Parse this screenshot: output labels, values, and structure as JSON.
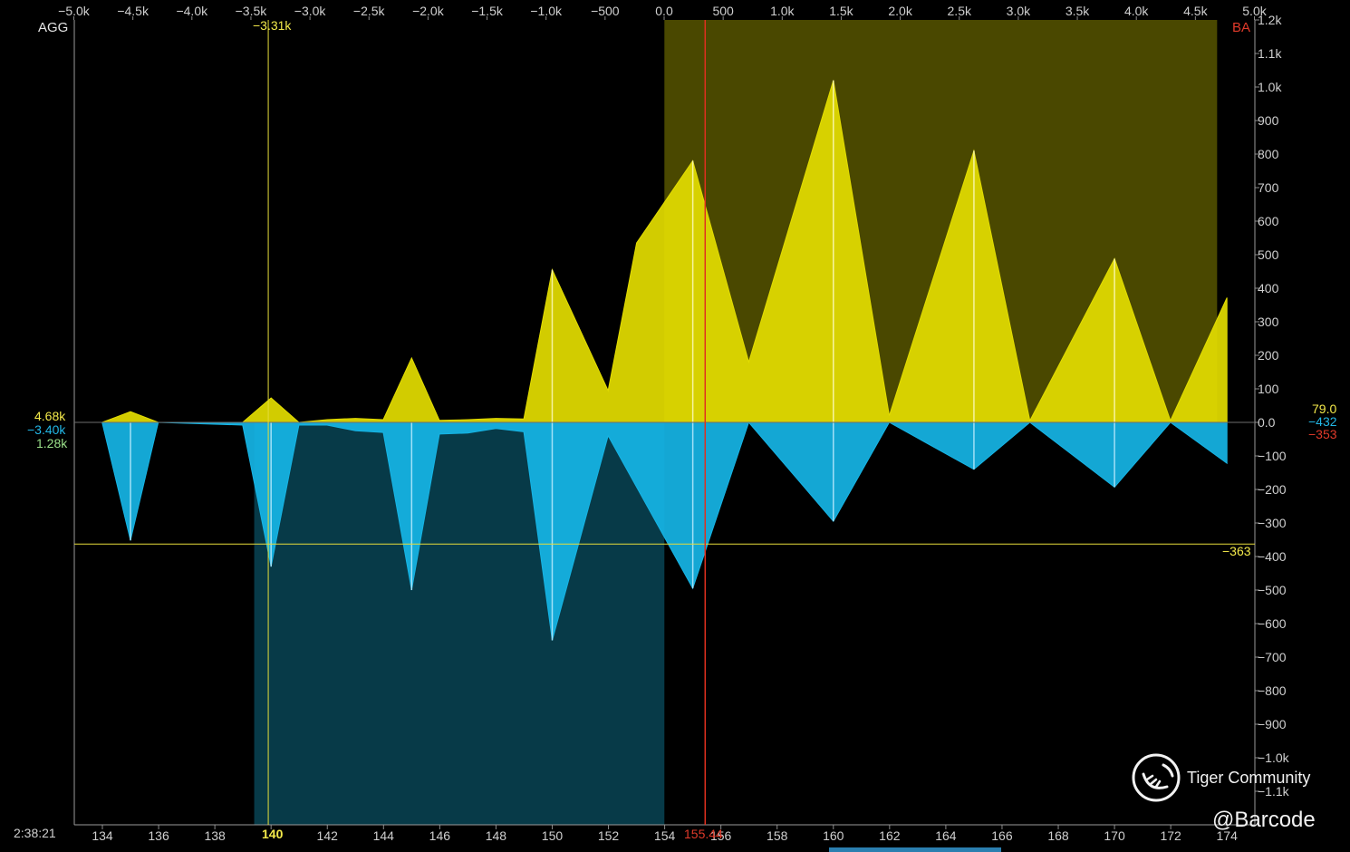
{
  "chart_data": {
    "type": "area",
    "top_axis_labels": [
      "−5.0k",
      "−4.5k",
      "−4.0k",
      "−3.5k",
      "−3.0k",
      "−2.5k",
      "−2.0k",
      "−1.5k",
      "−1.0k",
      "−500",
      "0.0",
      "500",
      "1.0k",
      "1.5k",
      "2.0k",
      "2.5k",
      "3.0k",
      "3.5k",
      "4.0k",
      "4.5k",
      "5.0k"
    ],
    "top_axis_range": [
      -5000,
      5000
    ],
    "y_axis_labels": [
      "1.2k",
      "1.1k",
      "1.0k",
      "900",
      "800",
      "700",
      "600",
      "500",
      "400",
      "300",
      "200",
      "100",
      "0.0",
      "−100",
      "−200",
      "−300",
      "−400",
      "−500",
      "−600",
      "−700",
      "−800",
      "−900",
      "−1.0k",
      "−1.1k"
    ],
    "y_range": [
      -1200,
      1200
    ],
    "bottom_axis_labels": [
      "134",
      "136",
      "138",
      "140",
      "142",
      "144",
      "146",
      "148",
      "150",
      "152",
      "154",
      "156",
      "158",
      "160",
      "162",
      "164",
      "166",
      "168",
      "170",
      "172",
      "174"
    ],
    "x_range": [
      133,
      174
    ],
    "series": [
      {
        "color": "#e2dc00",
        "points": [
          [
            133,
            0
          ],
          [
            133.99,
            0
          ],
          [
            135,
            32
          ],
          [
            135.99,
            0
          ],
          [
            138.99,
            0
          ],
          [
            140,
            73
          ],
          [
            140.99,
            0
          ],
          [
            141.99,
            8
          ],
          [
            143,
            12
          ],
          [
            143.99,
            8
          ],
          [
            145,
            192
          ],
          [
            145.99,
            6
          ],
          [
            147,
            8
          ],
          [
            148,
            12
          ],
          [
            148.99,
            10
          ],
          [
            150,
            455
          ],
          [
            151.99,
            95
          ],
          [
            153,
            535
          ],
          [
            155,
            780
          ],
          [
            156.99,
            180
          ],
          [
            160,
            1020
          ],
          [
            161.99,
            20
          ],
          [
            165,
            810
          ],
          [
            166.99,
            5
          ],
          [
            170,
            488
          ],
          [
            171.99,
            5
          ],
          [
            174,
            372
          ]
        ]
      },
      {
        "color": "#16b4e4",
        "points": [
          [
            133,
            0
          ],
          [
            133.99,
            0
          ],
          [
            135,
            -352
          ],
          [
            135.99,
            0
          ],
          [
            138.99,
            -8
          ],
          [
            140,
            -430
          ],
          [
            140.99,
            -8
          ],
          [
            141.99,
            -8
          ],
          [
            143,
            -25
          ],
          [
            143.99,
            -30
          ],
          [
            145,
            -500
          ],
          [
            145.99,
            -35
          ],
          [
            147,
            -32
          ],
          [
            148,
            -18
          ],
          [
            148.99,
            -28
          ],
          [
            150,
            -650
          ],
          [
            151.99,
            -40
          ],
          [
            155,
            -495
          ],
          [
            156.99,
            0
          ],
          [
            160,
            -295
          ],
          [
            161.99,
            0
          ],
          [
            165,
            -140
          ],
          [
            166.99,
            0
          ],
          [
            170,
            -193
          ],
          [
            171.99,
            0
          ],
          [
            174,
            -122
          ]
        ]
      }
    ],
    "markers": [
      {
        "x": 150,
        "y": 455
      },
      {
        "x": 155,
        "y": 780
      },
      {
        "x": 160,
        "y": 1020
      },
      {
        "x": 165,
        "y": 810
      },
      {
        "x": 170,
        "y": 488
      },
      {
        "x": 150,
        "y": -650
      },
      {
        "x": 145,
        "y": -500
      },
      {
        "x": 155,
        "y": -495
      },
      {
        "x": 140,
        "y": -430
      },
      {
        "x": 135,
        "y": -352
      },
      {
        "x": 160,
        "y": -295
      },
      {
        "x": 170,
        "y": -193
      },
      {
        "x": 165,
        "y": -140
      }
    ],
    "regions": [
      {
        "x_from": 153.99,
        "x_to": 173.65,
        "y_from": 0,
        "y_to": 1200,
        "color": "#4a4800"
      },
      {
        "x_from": 139.4,
        "x_to": 153.99,
        "y_from": -1200,
        "y_to": 0,
        "color": "#073a48"
      }
    ],
    "crosshair": {
      "x": 139.9,
      "y": -363,
      "x_label": "−3.31k",
      "y_label": "−363",
      "price_label": "140"
    },
    "spot": {
      "x": 155.44,
      "label": "155.44"
    },
    "grid": false
  },
  "labels": {
    "left_tag": "AGG",
    "right_tag": "BA",
    "time": "2:38:21",
    "left_values": [
      "4.68k",
      "−3.40k",
      "1.28k"
    ],
    "right_values": [
      "79.0",
      "−432",
      "−353"
    ]
  },
  "watermark": {
    "brand": "Tiger Community",
    "handle": "@Barcode"
  }
}
